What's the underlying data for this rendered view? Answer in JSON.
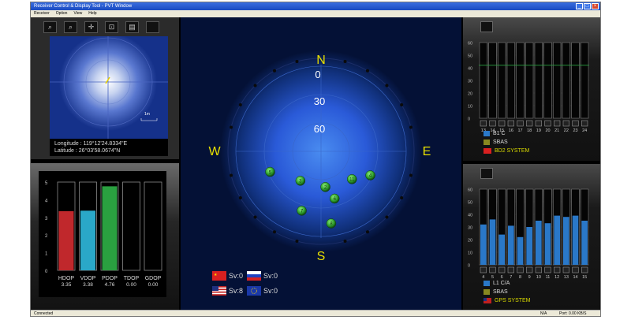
{
  "window": {
    "title": "Receiver Control & Display Tool - PVT Window",
    "menu": [
      "Receiver",
      "Option",
      "View",
      "Help"
    ],
    "status_left": "Connected",
    "status_right_1": "N/A",
    "status_right_2": "Port: 0.00 KB/S"
  },
  "toolbar": {
    "icons": [
      "zoom-in-icon",
      "zoom-out-icon",
      "crosshair-icon",
      "fit-icon",
      "delete-icon",
      "blank-icon"
    ]
  },
  "location": {
    "scale_label": "1m",
    "longitude_label": "Longitude  :",
    "longitude_value": "119°12'24.8334\"E",
    "latitude_label": "Latitude    :",
    "latitude_value": "26°03'58.0674\"N"
  },
  "dop": {
    "y_ticks": [
      "5",
      "4",
      "3",
      "2",
      "1",
      "0"
    ],
    "bars": [
      {
        "label": "HDOP",
        "value": 3.35,
        "value_text": "3.35",
        "color": "#c0282c"
      },
      {
        "label": "VDOP",
        "value": 3.38,
        "value_text": "3.38",
        "color": "#2aa8c8"
      },
      {
        "label": "PDOP",
        "value": 4.76,
        "value_text": "4.76",
        "color": "#2aa040"
      },
      {
        "label": "TDOP",
        "value": 0,
        "value_text": "0.00",
        "color": "#888888"
      },
      {
        "label": "GDOP",
        "value": 0,
        "value_text": "0.00",
        "color": "#888888"
      }
    ],
    "max": 5
  },
  "skyplot": {
    "north": "N",
    "south": "S",
    "east": "E",
    "west": "W",
    "elev_labels": [
      "0",
      "30",
      "60"
    ],
    "satellites": [
      {
        "id": "5",
        "az": 248,
        "el": 32
      },
      {
        "id": "3",
        "az": 215,
        "el": 52
      },
      {
        "id": "2",
        "az": 173,
        "el": 52
      },
      {
        "id": "11",
        "az": 132,
        "el": 46
      },
      {
        "id": "4",
        "az": 116,
        "el": 32
      },
      {
        "id": "6",
        "az": 164,
        "el": 38
      },
      {
        "id": "7",
        "az": 198,
        "el": 24
      },
      {
        "id": "8",
        "az": 172,
        "el": 13
      }
    ],
    "systems": [
      {
        "name": "china-flag",
        "text": "Sv:0"
      },
      {
        "name": "russia-flag",
        "text": "Sv:0"
      },
      {
        "name": "usa-flag",
        "text": "Sv:8"
      },
      {
        "name": "eu-flag",
        "text": "Sv:0"
      }
    ]
  },
  "bd2_panel": {
    "y_ticks": [
      "60",
      "50",
      "40",
      "30",
      "20",
      "10",
      "0"
    ],
    "threshold": 42,
    "prn": [
      "13",
      "14",
      "15",
      "16",
      "17",
      "18",
      "19",
      "20",
      "21",
      "22",
      "23",
      "24"
    ],
    "values": [
      0,
      0,
      0,
      0,
      0,
      0,
      0,
      0,
      0,
      0,
      0,
      0
    ],
    "legend": [
      {
        "text": "B1 C",
        "color": "#2a78c8"
      },
      {
        "text": "SBAS",
        "color": "#888820"
      },
      {
        "text": "BD2 SYSTEM",
        "color": "#d8d800"
      }
    ]
  },
  "gps_panel": {
    "y_ticks": [
      "60",
      "50",
      "40",
      "30",
      "20",
      "10",
      "0"
    ],
    "prn": [
      "4",
      "5",
      "6",
      "7",
      "8",
      "9",
      "10",
      "11",
      "12",
      "13",
      "14",
      "15"
    ],
    "values": [
      32,
      36,
      24,
      31,
      22,
      30,
      35,
      33,
      39,
      38,
      39,
      35
    ],
    "legend": [
      {
        "text": "L1 C/A",
        "color": "#2a78c8"
      },
      {
        "text": "SBAS",
        "color": "#888820"
      },
      {
        "text": "GPS SYSTEM",
        "color": "#d8d800"
      }
    ]
  }
}
